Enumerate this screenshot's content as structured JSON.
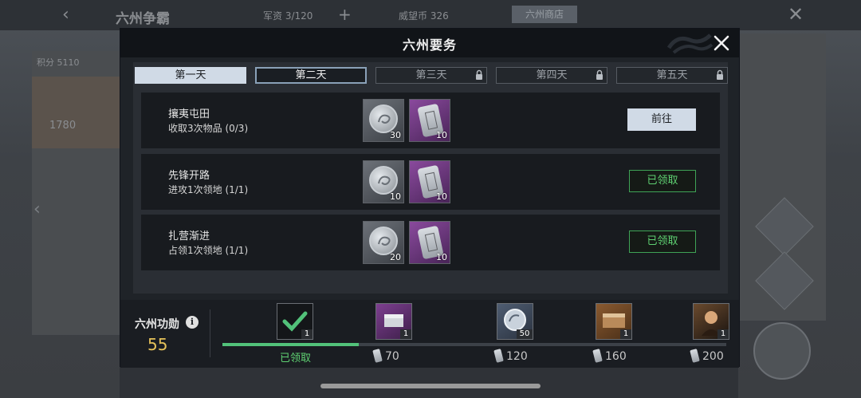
{
  "background": {
    "title": "六州争霸",
    "stat_1": "军资 3/120",
    "stat_2": "威望币 326",
    "shop_label": "六州商店",
    "left_stat": "积分 5110",
    "left_value": "1780"
  },
  "modal": {
    "title": "六州要务"
  },
  "tabs": [
    {
      "label": "第一天",
      "state": "completed",
      "locked": false
    },
    {
      "label": "第二天",
      "state": "selected",
      "locked": false
    },
    {
      "label": "第三天",
      "state": "locked",
      "locked": true
    },
    {
      "label": "第四天",
      "state": "locked",
      "locked": true
    },
    {
      "label": "第五天",
      "state": "locked",
      "locked": true
    }
  ],
  "tasks": [
    {
      "title": "攘夷屯田",
      "subtitle": "收取3次物品 (0/3)",
      "rewards": [
        {
          "icon": "silver-coin-icon",
          "count": "30"
        },
        {
          "icon": "command-token-icon",
          "count": "10"
        }
      ],
      "action": "前往",
      "action_state": "go"
    },
    {
      "title": "先锋开路",
      "subtitle": "进攻1次领地 (1/1)",
      "rewards": [
        {
          "icon": "silver-coin-icon",
          "count": "10"
        },
        {
          "icon": "command-token-icon",
          "count": "10"
        }
      ],
      "action": "已领取",
      "action_state": "claimed"
    },
    {
      "title": "扎营渐进",
      "subtitle": "占领1次领地 (1/1)",
      "rewards": [
        {
          "icon": "silver-coin-icon",
          "count": "20"
        },
        {
          "icon": "command-token-icon",
          "count": "10"
        }
      ],
      "action": "已领取",
      "action_state": "claimed"
    }
  ],
  "merit": {
    "label": "六州功勋",
    "value": "55",
    "progress_fraction": 0.27,
    "milestones": [
      {
        "icon": "claimed-check-icon",
        "count": "1",
        "label": "已领取",
        "claimed": true
      },
      {
        "icon": "purple-chest-icon",
        "count": "1",
        "label": "70",
        "claimed": false
      },
      {
        "icon": "blue-token-icon",
        "count": "50",
        "label": "120",
        "claimed": false
      },
      {
        "icon": "wooden-chest-icon",
        "count": "1",
        "label": "160",
        "claimed": false
      },
      {
        "icon": "general-portrait-icon",
        "count": "1",
        "label": "200",
        "claimed": false
      }
    ]
  },
  "colors": {
    "accent_light": "#d0dae6",
    "claimed_green": "#5fd172",
    "merit_gold": "#e6c25a"
  }
}
